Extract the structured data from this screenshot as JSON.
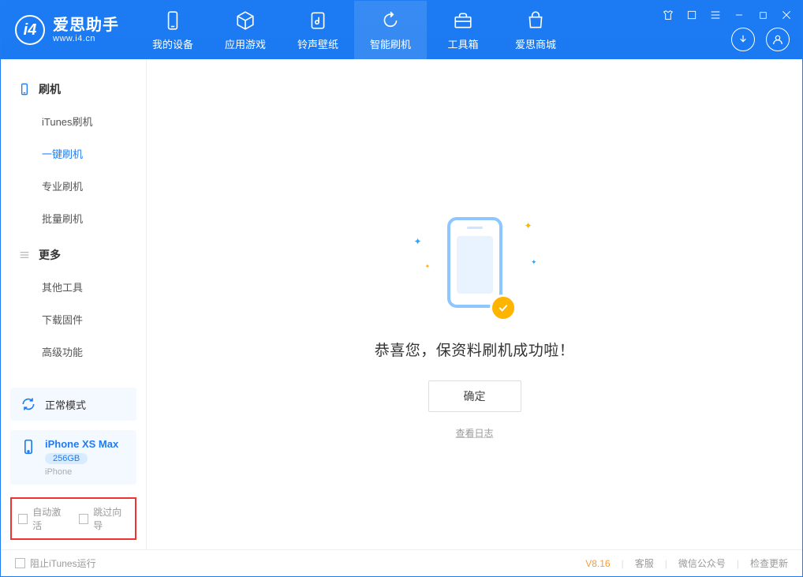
{
  "app": {
    "name_cn": "爱思助手",
    "name_en": "www.i4.cn"
  },
  "nav": [
    {
      "label": "我的设备",
      "icon": "device"
    },
    {
      "label": "应用游戏",
      "icon": "cube"
    },
    {
      "label": "铃声壁纸",
      "icon": "music"
    },
    {
      "label": "智能刷机",
      "icon": "refresh",
      "active": true
    },
    {
      "label": "工具箱",
      "icon": "toolbox"
    },
    {
      "label": "爱思商城",
      "icon": "bag"
    }
  ],
  "win_controls": {
    "shirt": "shirt",
    "skin": "box",
    "menu": "menu",
    "min": "min",
    "max": "max",
    "close": "close"
  },
  "header_actions": {
    "download": "download",
    "account": "account"
  },
  "sidebar": {
    "group1_title": "刷机",
    "items1": [
      "iTunes刷机",
      "一键刷机",
      "专业刷机",
      "批量刷机"
    ],
    "active1_index": 1,
    "group2_title": "更多",
    "items2": [
      "其他工具",
      "下载固件",
      "高级功能"
    ]
  },
  "mode_card": {
    "label": "正常模式"
  },
  "device_card": {
    "name": "iPhone XS Max",
    "storage": "256GB",
    "type": "iPhone"
  },
  "options": {
    "auto_activate": "自动激活",
    "skip_guide": "跳过向导"
  },
  "main": {
    "success_text": "恭喜您，保资料刷机成功啦！",
    "ok_button": "确定",
    "view_log": "查看日志"
  },
  "footer": {
    "block_itunes": "阻止iTunes运行",
    "version": "V8.16",
    "links": [
      "客服",
      "微信公众号",
      "检查更新"
    ]
  }
}
